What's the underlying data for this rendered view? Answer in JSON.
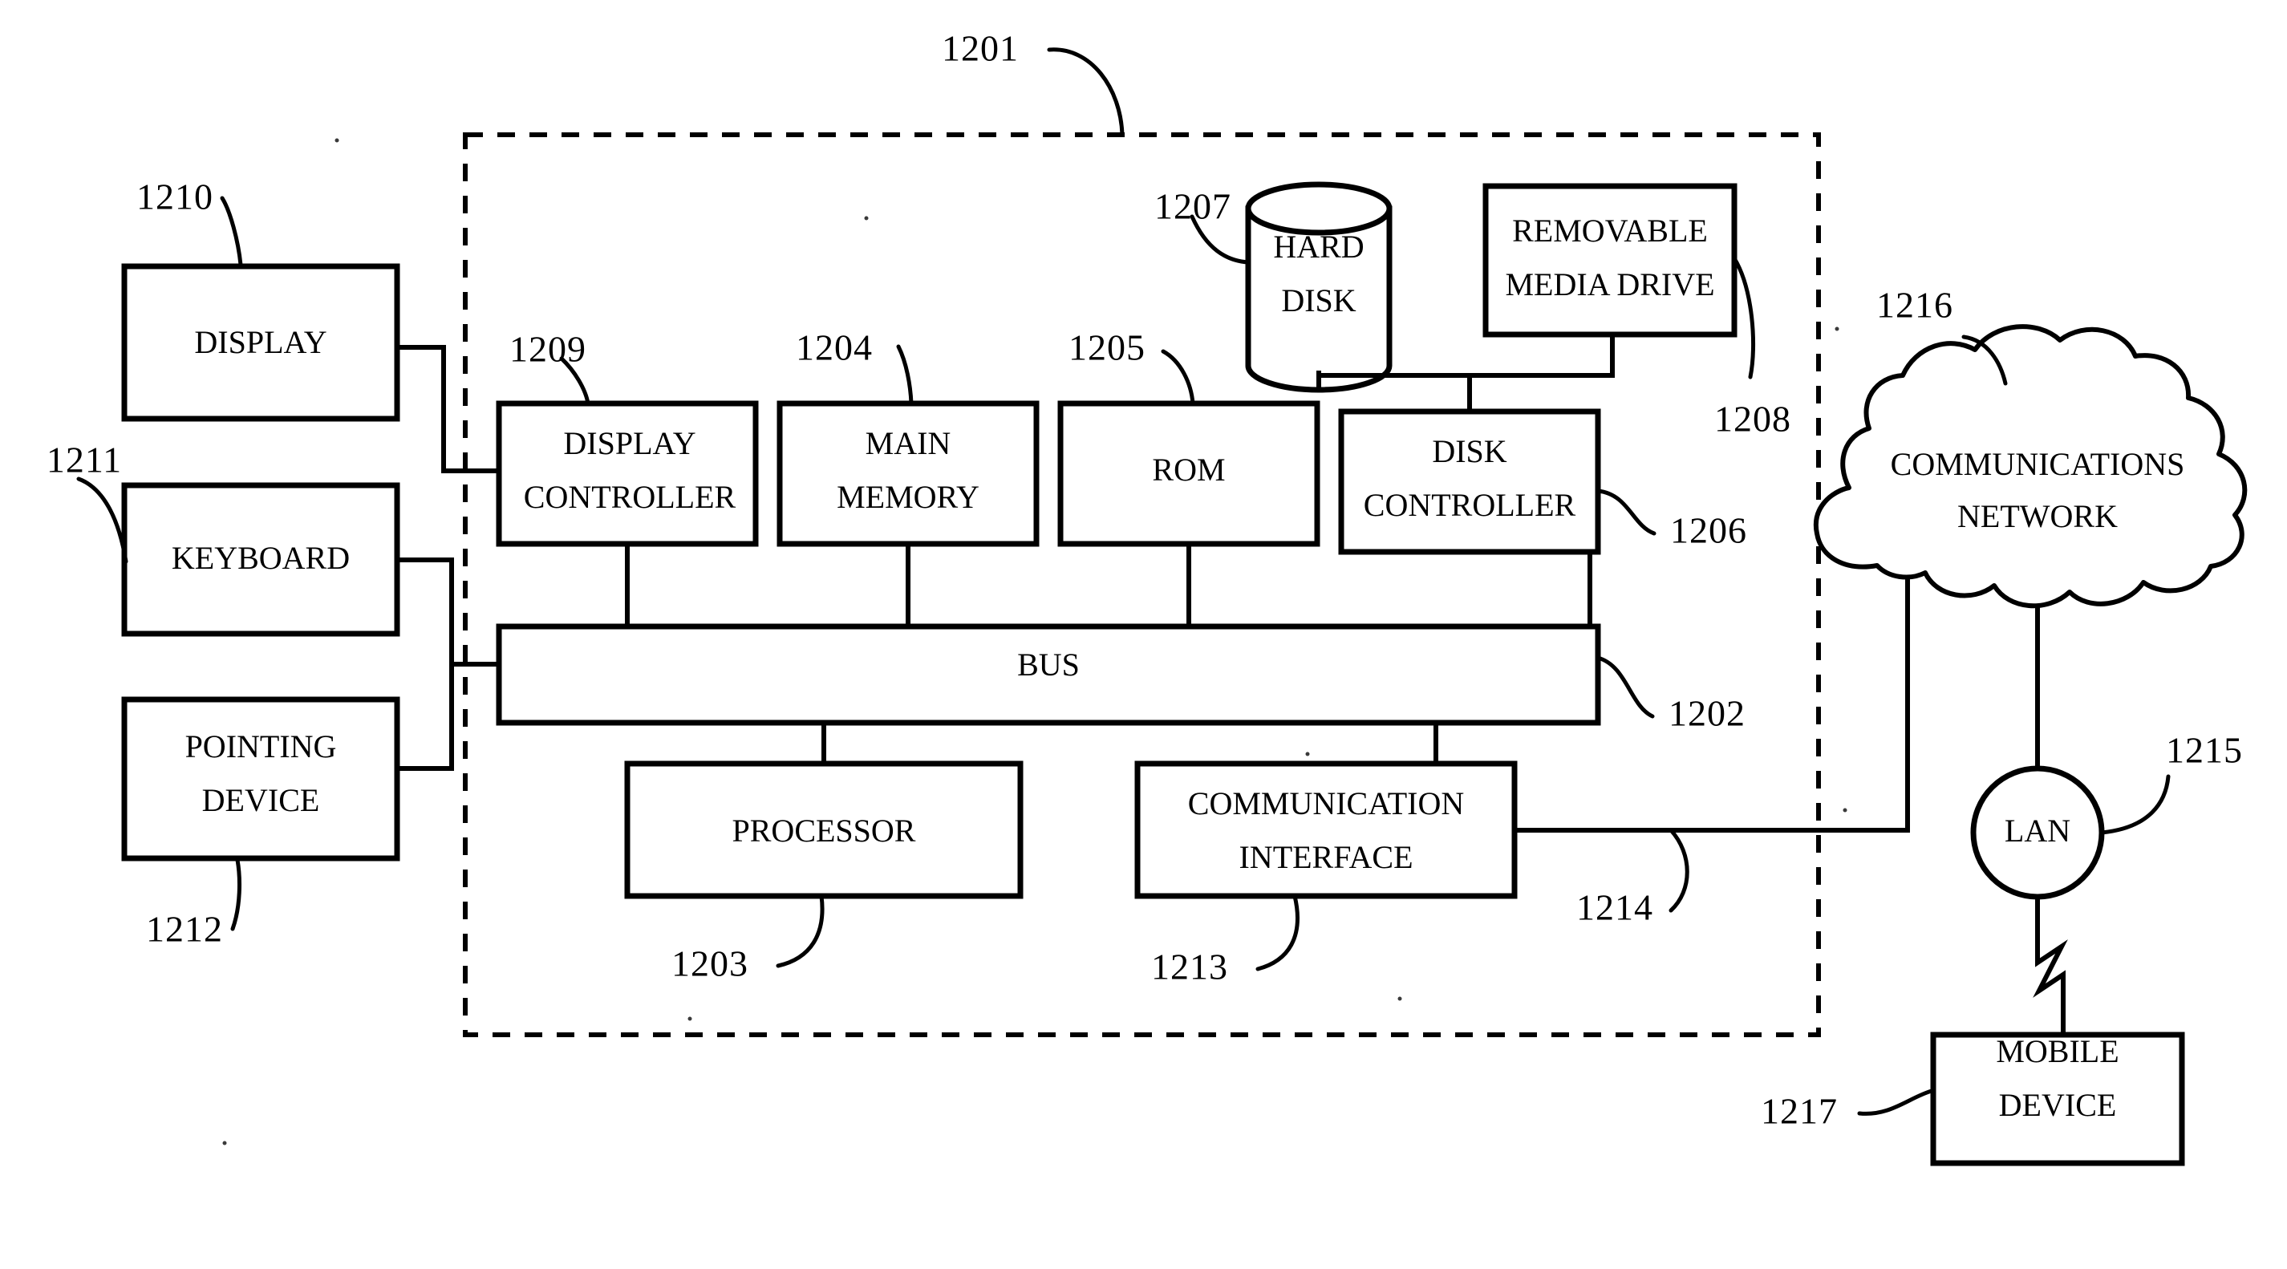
{
  "figure": {
    "title": "Computer system block diagram",
    "type": "patent-figure",
    "background_color": "#ffffff",
    "line_color": "#000000"
  },
  "system_boundary": {
    "ref": "1201",
    "style": "dashed"
  },
  "blocks": {
    "display": {
      "label": "DISPLAY",
      "ref": "1210"
    },
    "keyboard": {
      "label": "KEYBOARD",
      "ref": "1211"
    },
    "pointing_device": {
      "label_line1": "POINTING",
      "label_line2": "DEVICE",
      "ref": "1212"
    },
    "display_controller": {
      "label_line1": "DISPLAY",
      "label_line2": "CONTROLLER",
      "ref": "1209"
    },
    "main_memory": {
      "label_line1": "MAIN",
      "label_line2": "MEMORY",
      "ref": "1204"
    },
    "rom": {
      "label": "ROM",
      "ref": "1205"
    },
    "disk_controller": {
      "label_line1": "DISK",
      "label_line2": "CONTROLLER",
      "ref": "1206"
    },
    "hard_disk": {
      "label_line1": "HARD",
      "label_line2": "DISK",
      "ref": "1207",
      "shape": "cylinder"
    },
    "removable_media_drive": {
      "label_line1": "REMOVABLE",
      "label_line2": "MEDIA DRIVE",
      "ref": "1208"
    },
    "bus": {
      "label": "BUS",
      "ref": "1202"
    },
    "processor": {
      "label": "PROCESSOR",
      "ref": "1203"
    },
    "communication_interface": {
      "label_line1": "COMMUNICATION",
      "label_line2": "INTERFACE",
      "ref": "1213"
    },
    "network_link": {
      "ref": "1214"
    },
    "lan": {
      "label": "LAN",
      "ref": "1215",
      "shape": "circle"
    },
    "communications_network": {
      "label_line1": "COMMUNICATIONS",
      "label_line2": "NETWORK",
      "ref": "1216",
      "shape": "cloud"
    },
    "mobile_device": {
      "label_line1": "MOBILE",
      "label_line2": "DEVICE",
      "ref": "1217"
    }
  },
  "reference_numerals": [
    "1201",
    "1202",
    "1203",
    "1204",
    "1205",
    "1206",
    "1207",
    "1208",
    "1209",
    "1210",
    "1211",
    "1212",
    "1213",
    "1214",
    "1215",
    "1216",
    "1217"
  ],
  "connections": [
    {
      "from": "display",
      "to": "display_controller"
    },
    {
      "from": "keyboard",
      "to": "bus"
    },
    {
      "from": "pointing_device",
      "to": "bus"
    },
    {
      "from": "display_controller",
      "to": "bus"
    },
    {
      "from": "main_memory",
      "to": "bus"
    },
    {
      "from": "rom",
      "to": "bus"
    },
    {
      "from": "disk_controller",
      "to": "bus"
    },
    {
      "from": "hard_disk",
      "to": "disk_controller"
    },
    {
      "from": "removable_media_drive",
      "to": "disk_controller"
    },
    {
      "from": "bus",
      "to": "processor"
    },
    {
      "from": "bus",
      "to": "communication_interface"
    },
    {
      "from": "communication_interface",
      "to": "lan"
    },
    {
      "from": "lan",
      "to": "communications_network"
    },
    {
      "from": "lan",
      "to": "mobile_device",
      "style": "wireless"
    }
  ]
}
